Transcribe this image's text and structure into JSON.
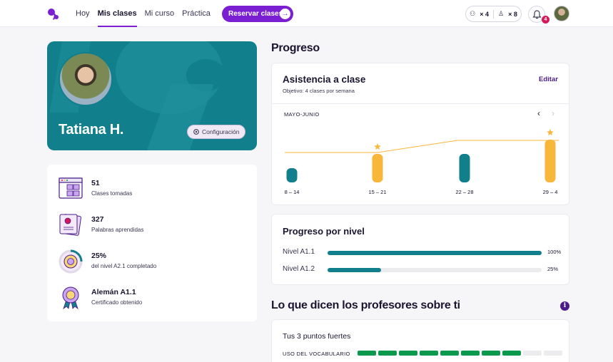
{
  "nav": {
    "items": [
      "Hoy",
      "Mis clases",
      "Mi curso",
      "Práctica"
    ],
    "active": "Mis clases",
    "reserve_label": "Reservar clases"
  },
  "header": {
    "counter_a": "× 4",
    "counter_b": "× 8",
    "notifications": "4"
  },
  "profile": {
    "name": "Tatiana H.",
    "config_label": "Configuración"
  },
  "stats": [
    {
      "value": "51",
      "label": "Clases tomadas",
      "icon": "calendar-icon"
    },
    {
      "value": "327",
      "label": "Palabras aprendidas",
      "icon": "flashcards-icon"
    },
    {
      "value": "25%",
      "label": "del nivel A2.1 completado",
      "icon": "level-progress-icon"
    },
    {
      "value": "Alemán A1.1",
      "label": "Certificado obtenido",
      "icon": "certificate-badge-icon"
    }
  ],
  "progress": {
    "heading": "Progreso",
    "attendance": {
      "title": "Asistencia a clase",
      "subtitle": "Objetivo: 4 clases por semana",
      "edit_label": "Editar",
      "range_label": "MAYO-JUNIO"
    },
    "levels": {
      "title": "Progreso por nivel",
      "rows": [
        {
          "name": "Nivel A1.1",
          "percent": 100,
          "label": "100%"
        },
        {
          "name": "Nivel A1.2",
          "percent": 25,
          "label": "25%"
        }
      ]
    }
  },
  "teachers": {
    "heading": "Lo que dicen los profesores sobre ti",
    "strengths_title": "Tus 3 puntos fuertes",
    "row_label": "USO DEL VOCABULARIO",
    "filled": 8,
    "total": 10
  },
  "colors": {
    "accent": "#7a1fd1",
    "teal": "#117f8c",
    "gold": "#f8b63a",
    "green": "#0b9a4d"
  },
  "chart_data": {
    "type": "bar",
    "categories": [
      "8 – 14",
      "15 – 21",
      "22 – 28",
      "29 – 4"
    ],
    "values": [
      1,
      2,
      2,
      3
    ],
    "goal_reached": [
      false,
      true,
      false,
      true
    ],
    "title": "Asistencia a clase",
    "xlabel": "",
    "ylabel": "",
    "ylim": [
      0,
      3
    ],
    "grid": false
  }
}
